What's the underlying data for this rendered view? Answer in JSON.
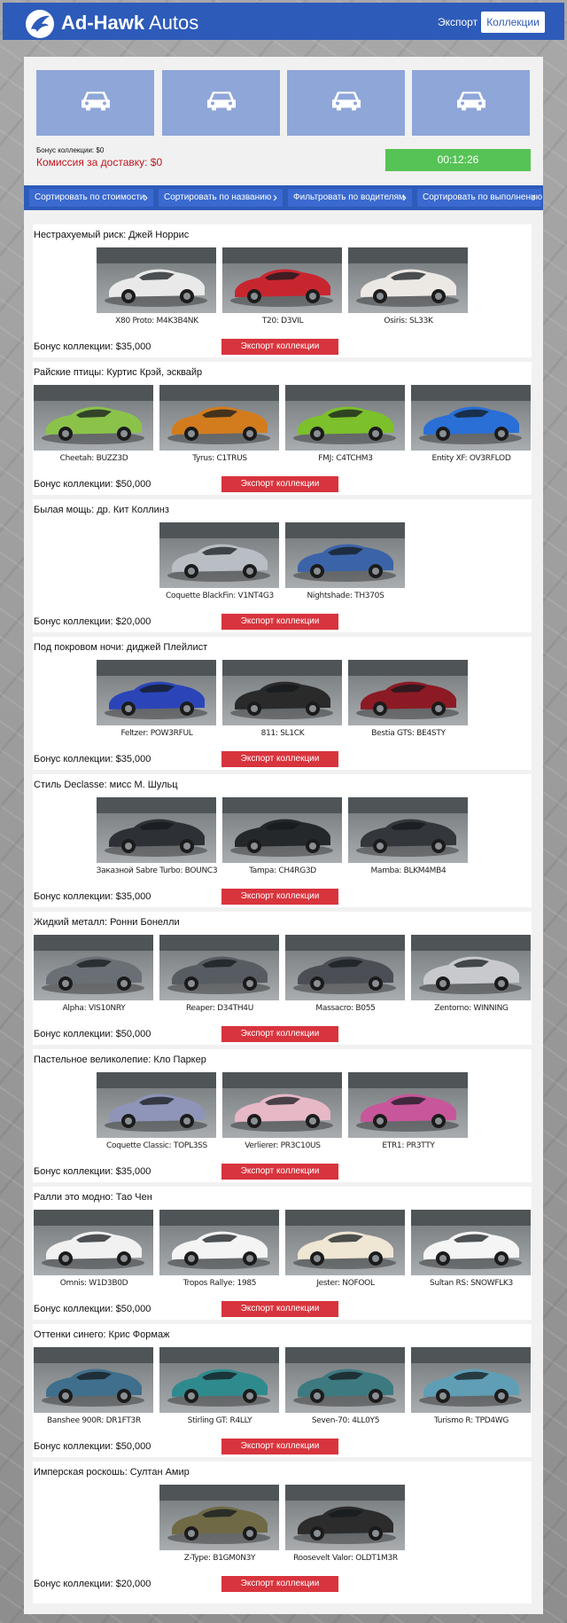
{
  "header": {
    "brand_bold": "Ad-Hawk",
    "brand_light": " Autos",
    "export_link": "Экспорт",
    "collections_button": "Коллекции"
  },
  "summary": {
    "slot_icons": [
      "car-icon",
      "car-icon",
      "car-icon",
      "car-icon"
    ],
    "bonus_label": "Бонус коллекции: $0",
    "delivery_fee": "Комиссия за доставку: $0",
    "timer": "00:12:26"
  },
  "sort": [
    {
      "label": "Сортировать по стоимости"
    },
    {
      "label": "Сортировать по названию"
    },
    {
      "label": "Фильтровать по водителям"
    },
    {
      "label": "Сортировать по выполнению"
    }
  ],
  "export_button_label": "Экспорт коллекции",
  "collections": [
    {
      "title": "Нестрахуемый риск: Джей Норрис",
      "bonus": "Бонус коллекции: $35,000",
      "cars": [
        {
          "label": "X80 Proto: M4K3B4NK",
          "color": "#e9e9e9"
        },
        {
          "label": "T20: D3VIL",
          "color": "#c8262f"
        },
        {
          "label": "Osiris: SL33K",
          "color": "#ece8e4"
        }
      ]
    },
    {
      "title": "Райские птицы:  Куртис Крэй, эсквайр",
      "bonus": "Бонус коллекции: $50,000",
      "cars": [
        {
          "label": "Cheetah: BUZZ3D",
          "color": "#8bc34a"
        },
        {
          "label": "Tyrus: C1TRUS",
          "color": "#d27c1e"
        },
        {
          "label": "FMJ: C4TCHM3",
          "color": "#7cc02b"
        },
        {
          "label": "Entity XF: OV3RFLOD",
          "color": "#2a6fd6"
        }
      ]
    },
    {
      "title": "Былая мощь: др. Кит Коллинз",
      "bonus": "Бонус коллекции: $20,000",
      "cars": [
        {
          "label": "Coquette BlackFin: V1NT4G3",
          "color": "#b9bec4"
        },
        {
          "label": "Nightshade: TH370S",
          "color": "#3b63a8"
        }
      ]
    },
    {
      "title": "Под покровом ночи: диджей Плейлист",
      "bonus": "Бонус коллекции: $35,000",
      "cars": [
        {
          "label": "Feltzer: POW3RFUL",
          "color": "#2b45b8"
        },
        {
          "label": "811: SL1CK",
          "color": "#2a2a2a"
        },
        {
          "label": "Bestia GTS: BE4STY",
          "color": "#8c1a24"
        }
      ]
    },
    {
      "title": "Стиль Declasse: мисс М. Шульц",
      "bonus": "Бонус коллекции: $35,000",
      "cars": [
        {
          "label": "Заказной Sabre Turbo: BOUNC3",
          "color": "#2d3136"
        },
        {
          "label": "Tampa: CH4RG3D",
          "color": "#25282b"
        },
        {
          "label": "Mamba: BLKM4MB4",
          "color": "#33373b"
        }
      ]
    },
    {
      "title": "Жидкий металл: Ронни Бонелли",
      "bonus": "Бонус коллекции: $50,000",
      "cars": [
        {
          "label": "Alpha: VIS10NRY",
          "color": "#6a6f75"
        },
        {
          "label": "Reaper: D34TH4U",
          "color": "#575c62"
        },
        {
          "label": "Massacro: B055",
          "color": "#4b4f55"
        },
        {
          "label": "Zentorno: WINNING",
          "color": "#c7c9cc"
        }
      ]
    },
    {
      "title": "Пастельное великолепие: Кло Паркер",
      "bonus": "Бонус коллекции: $35,000",
      "cars": [
        {
          "label": "Coquette Classic: TOPL3SS",
          "color": "#8f95b8"
        },
        {
          "label": "Verlierer: PR3C10US",
          "color": "#e7b8c6"
        },
        {
          "label": "ETR1: PR3TTY",
          "color": "#c8569a"
        }
      ]
    },
    {
      "title": "Ралли это модно: Тао Чен",
      "bonus": "Бонус коллекции: $50,000",
      "cars": [
        {
          "label": "Omnis: W1D3B0D",
          "color": "#f1f1f1"
        },
        {
          "label": "Tropos Rallye: 1985",
          "color": "#f4f4f4"
        },
        {
          "label": "Jester: NOFOOL",
          "color": "#efe6d4"
        },
        {
          "label": "Sultan RS: SNOWFLK3",
          "color": "#f5f5f5"
        }
      ]
    },
    {
      "title": "Оттенки синего: Крис Формаж",
      "bonus": "Бонус коллекции: $50,000",
      "cars": [
        {
          "label": "Banshee 900R: DR1FT3R",
          "color": "#3f6f8c"
        },
        {
          "label": "Stirling GT: R4LLY",
          "color": "#2f8a8e"
        },
        {
          "label": "Seven-70: 4LL0Y5",
          "color": "#3c7a80"
        },
        {
          "label": "Turismo R: TPD4WG",
          "color": "#5f9eb5"
        }
      ]
    },
    {
      "title": "Имперская роскошь: Султан Амир",
      "bonus": "Бонус коллекции: $20,000",
      "cars": [
        {
          "label": "Z-Type: B1GM0N3Y",
          "color": "#6f6a45"
        },
        {
          "label": "Roosevelt Valor: OLDT1M3R",
          "color": "#2c2c2c"
        }
      ]
    }
  ]
}
